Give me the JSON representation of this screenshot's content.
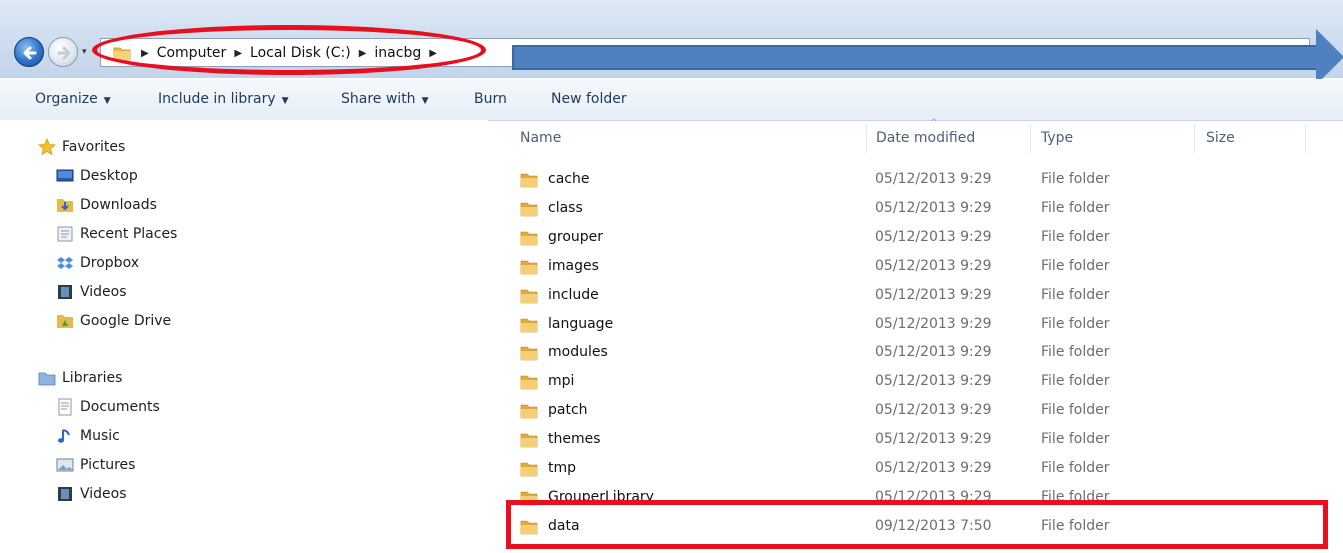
{
  "address": {
    "crumbs": [
      "Computer",
      "Local Disk (C:)",
      "inacbg"
    ]
  },
  "toolbar": {
    "organize": "Organize",
    "include_in_library": "Include in library",
    "share_with": "Share with",
    "burn": "Burn",
    "new_folder": "New folder"
  },
  "nav": {
    "favorites_header": "Favorites",
    "favorites": [
      "Desktop",
      "Downloads",
      "Recent Places",
      "Dropbox",
      "Videos",
      "Google Drive"
    ],
    "libraries_header": "Libraries",
    "libraries": [
      "Documents",
      "Music",
      "Pictures",
      "Videos"
    ]
  },
  "columns": {
    "name": "Name",
    "date_modified": "Date modified",
    "type": "Type",
    "size": "Size"
  },
  "files": [
    {
      "name": "cache",
      "date": "05/12/2013 9:29",
      "type": "File folder"
    },
    {
      "name": "class",
      "date": "05/12/2013 9:29",
      "type": "File folder"
    },
    {
      "name": "grouper",
      "date": "05/12/2013 9:29",
      "type": "File folder"
    },
    {
      "name": "images",
      "date": "05/12/2013 9:29",
      "type": "File folder"
    },
    {
      "name": "include",
      "date": "05/12/2013 9:29",
      "type": "File folder"
    },
    {
      "name": "language",
      "date": "05/12/2013 9:29",
      "type": "File folder"
    },
    {
      "name": "modules",
      "date": "05/12/2013 9:29",
      "type": "File folder"
    },
    {
      "name": "mpi",
      "date": "05/12/2013 9:29",
      "type": "File folder"
    },
    {
      "name": "patch",
      "date": "05/12/2013 9:29",
      "type": "File folder"
    },
    {
      "name": "themes",
      "date": "05/12/2013 9:29",
      "type": "File folder"
    },
    {
      "name": "tmp",
      "date": "05/12/2013 9:29",
      "type": "File folder"
    },
    {
      "name": "GrouperLibrary",
      "date": "05/12/2013 9:29",
      "type": "File folder"
    },
    {
      "name": "data",
      "date": "09/12/2013 7:50",
      "type": "File folder"
    }
  ],
  "annotations": {
    "highlight_color": "#e8101f",
    "arrow_color": "#4f80bf"
  },
  "icons": {
    "back": "back-arrow-icon",
    "forward": "forward-arrow-icon",
    "folder": "folder-icon"
  }
}
